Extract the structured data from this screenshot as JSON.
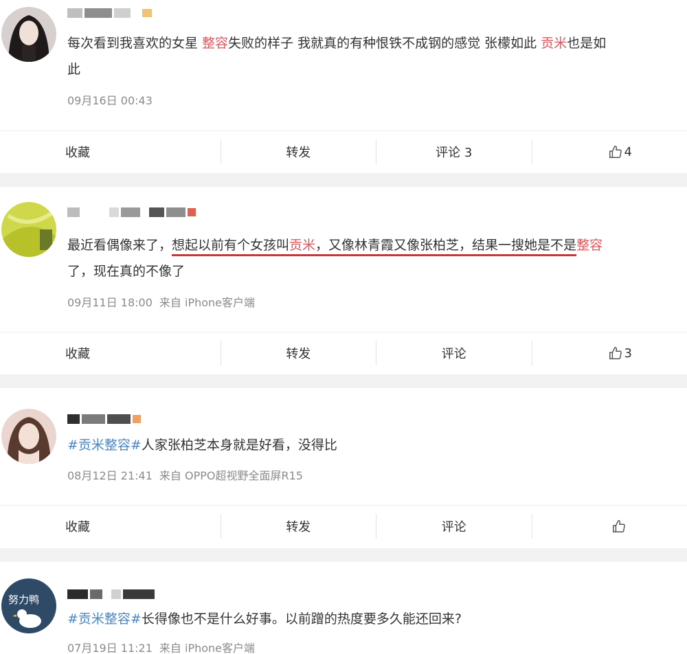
{
  "posts": [
    {
      "text": {
        "p1": "每次看到我喜欢的女星 ",
        "hl1": "整容",
        "p2": "失败的样子 我就真的有种恨铁不成钢的感觉 张檬如此 ",
        "hl2": "贡米",
        "p3": "也是如",
        "p4": "此"
      },
      "date": "09月16日 00:43",
      "source": "",
      "actions": {
        "collect": "收藏",
        "forward": "转发",
        "comment": "评论 3",
        "like_count": "4"
      }
    },
    {
      "text": {
        "p1": "最近看偶像来了，",
        "u1": "想起以前有个女孩叫",
        "hl1": "贡米",
        "u2": "，又像林青霞又像张柏芝，结果一搜她是不是",
        "hl2": "整容",
        "p2": "了，现在真的不像了"
      },
      "date": "09月11日 18:00",
      "source": "来自 iPhone客户端",
      "actions": {
        "collect": "收藏",
        "forward": "转发",
        "comment": "评论",
        "like_count": "3"
      }
    },
    {
      "text": {
        "tag": "#贡米整容#",
        "p1": "人家张柏芝本身就是好看，没得比"
      },
      "date": "08月12日 21:41",
      "source": "来自 OPPO超视野全面屏R15",
      "actions": {
        "collect": "收藏",
        "forward": "转发",
        "comment": "评论",
        "like_count": ""
      }
    },
    {
      "avatar_text": "努力鸭",
      "text": {
        "tag": "#贡米整容#",
        "p1": "长得像也不是什么好事。以前蹭的热度要多久能还回来?"
      },
      "date": "07月19日 11:21",
      "source": "来自 iPhone客户端"
    }
  ],
  "colors": {
    "highlight": "#e0565b",
    "hashtag": "#4d86c6",
    "underline": "#c8363c",
    "meta": "#8a8a8a"
  },
  "icons": {
    "like": "thumbs-up-icon"
  }
}
